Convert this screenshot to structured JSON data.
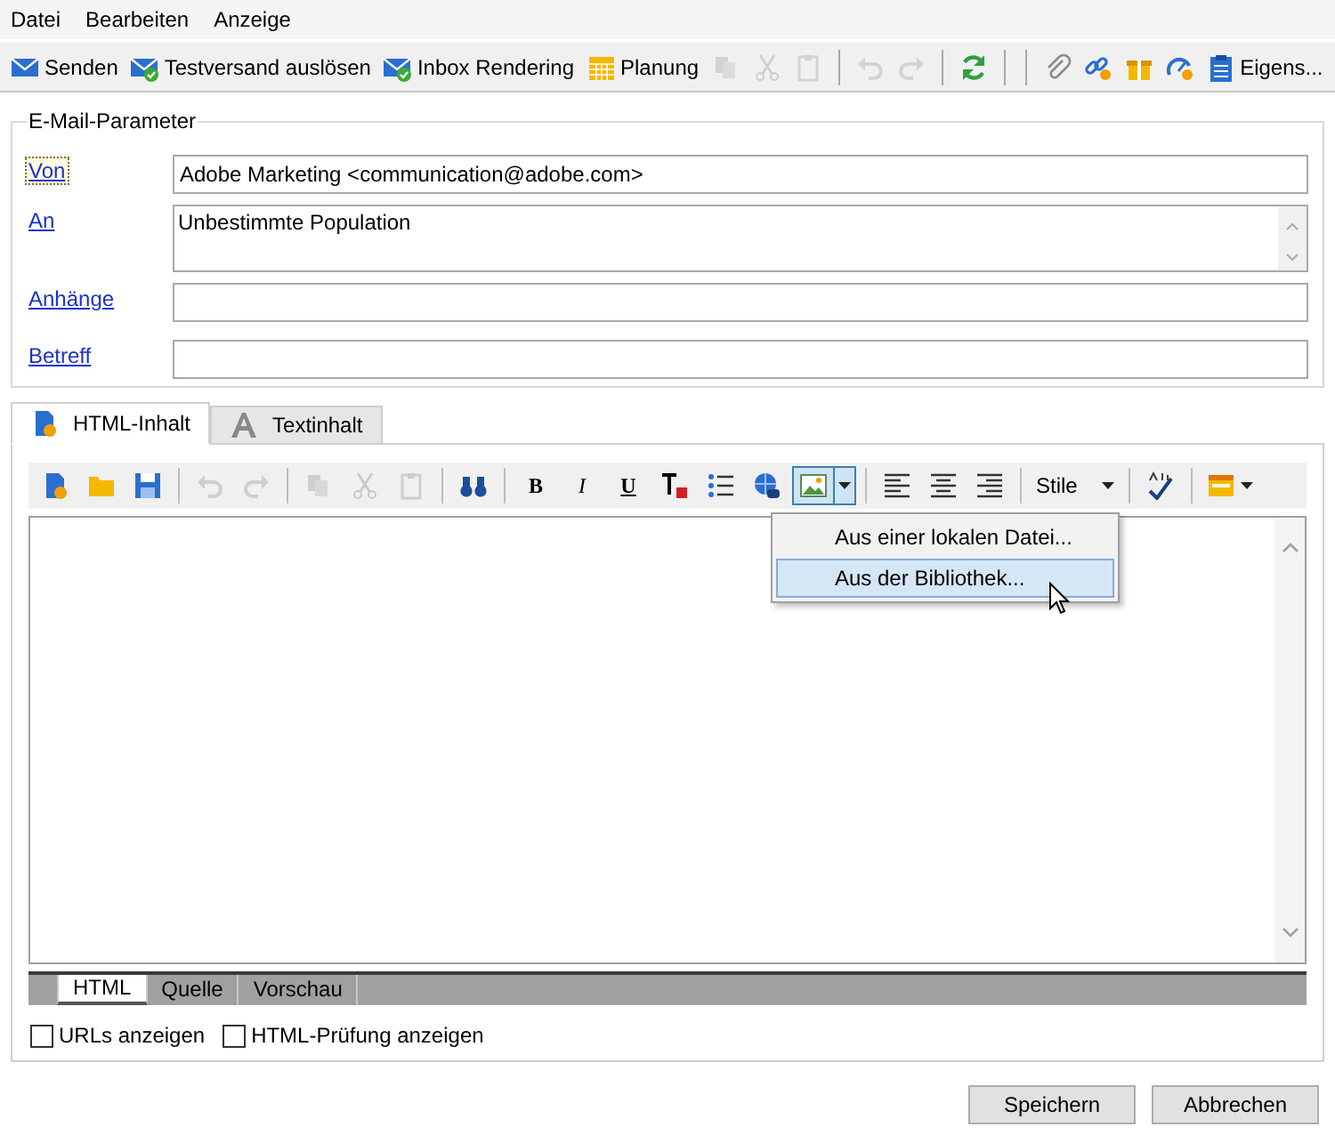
{
  "menu_bar": [
    {
      "label": "Datei"
    },
    {
      "label": "Bearbeiten"
    },
    {
      "label": "Anzeige"
    }
  ],
  "toolbar": [
    {
      "kind": "button",
      "label": "Senden",
      "disabled": false
    },
    {
      "kind": "button",
      "label": "Testversand auslösen",
      "disabled": false
    },
    {
      "kind": "button",
      "label": "Inbox Rendering",
      "disabled": false
    },
    {
      "kind": "button",
      "label": "Planung",
      "disabled": false
    },
    {
      "kind": "button",
      "disabled": true
    },
    {
      "kind": "button",
      "disabled": true
    },
    {
      "kind": "button",
      "disabled": true
    },
    {
      "kind": "separator"
    },
    {
      "kind": "button",
      "disabled": true
    },
    {
      "kind": "button",
      "disabled": true
    },
    {
      "kind": "separator"
    },
    {
      "kind": "button",
      "disabled": false
    },
    {
      "kind": "separator"
    },
    {
      "kind": "separator"
    },
    {
      "kind": "button",
      "disabled": false
    },
    {
      "kind": "button",
      "disabled": false
    },
    {
      "kind": "button",
      "disabled": false
    },
    {
      "kind": "button",
      "disabled": false
    },
    {
      "kind": "button",
      "label": "Eigens...",
      "disabled": false
    }
  ],
  "email_parameters": {
    "title": "E-Mail-Parameter",
    "fields": [
      {
        "kind": "line",
        "label": "Von",
        "focused": true,
        "value": "Adobe Marketing <communication@adobe.com>"
      },
      {
        "kind": "multiline",
        "label": "An",
        "focused": false,
        "value": "Unbestimmte Population"
      },
      {
        "kind": "line",
        "label": "Anhänge",
        "focused": false
      },
      {
        "kind": "line",
        "label": "Betreff",
        "focused": false
      }
    ]
  },
  "content_tabs": [
    {
      "label": "HTML-Inhalt",
      "selected": true
    },
    {
      "label": "Textinhalt",
      "selected": false
    }
  ],
  "editor_toolbar": [
    {
      "kind": "button",
      "disabled": false
    },
    {
      "kind": "button",
      "disabled": false
    },
    {
      "kind": "button",
      "disabled": false
    },
    {
      "kind": "separator"
    },
    {
      "kind": "button",
      "disabled": true
    },
    {
      "kind": "button",
      "disabled": true
    },
    {
      "kind": "separator"
    },
    {
      "kind": "button",
      "disabled": true
    },
    {
      "kind": "button",
      "disabled": true
    },
    {
      "kind": "button",
      "disabled": true
    },
    {
      "kind": "separator"
    },
    {
      "kind": "button",
      "disabled": false
    },
    {
      "kind": "separator"
    },
    {
      "kind": "text",
      "label": "B"
    },
    {
      "kind": "text",
      "label": "I"
    },
    {
      "kind": "text",
      "label": "U"
    },
    {
      "kind": "button",
      "disabled": false
    },
    {
      "kind": "button",
      "disabled": false
    },
    {
      "kind": "button",
      "disabled": false
    },
    {
      "kind": "split",
      "pressed": true
    },
    {
      "kind": "separator"
    },
    {
      "kind": "button",
      "disabled": false
    },
    {
      "kind": "button",
      "disabled": false
    },
    {
      "kind": "button",
      "disabled": false
    },
    {
      "kind": "separator"
    },
    {
      "kind": "dropdown",
      "label": "Stile"
    },
    {
      "kind": "separator"
    },
    {
      "kind": "button",
      "disabled": false
    },
    {
      "kind": "separator"
    },
    {
      "kind": "menu_button"
    }
  ],
  "image_menu": [
    {
      "label": "Aus einer lokalen Datei...",
      "selected": false
    },
    {
      "label": "Aus der Bibliothek...",
      "selected": true
    }
  ],
  "view_tabs": [
    {
      "label": "HTML",
      "selected": true
    },
    {
      "label": "Quelle",
      "selected": false
    },
    {
      "label": "Vorschau",
      "selected": false
    }
  ],
  "options": [
    {
      "label": "URLs anzeigen",
      "checked": false
    },
    {
      "label": "HTML-Prüfung anzeigen",
      "checked": false
    }
  ],
  "buttons": [
    {
      "label": "Speichern"
    },
    {
      "label": "Abbrechen"
    }
  ]
}
